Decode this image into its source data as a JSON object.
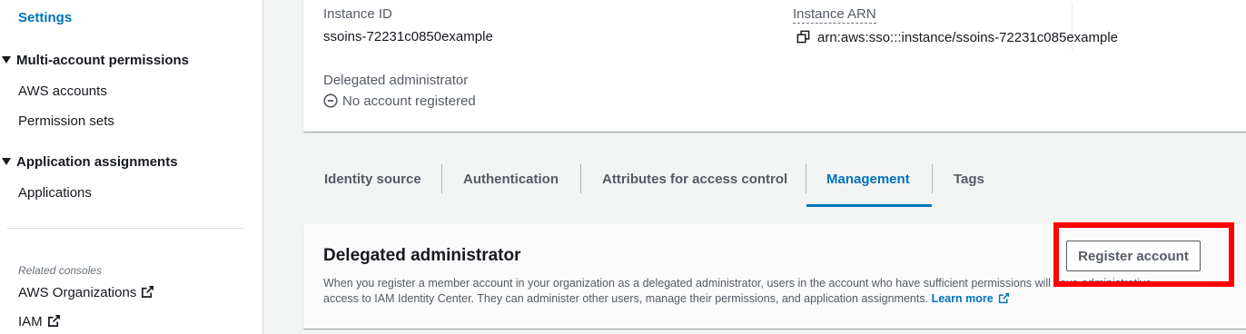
{
  "sidebar": {
    "active_item": "Settings",
    "sections": [
      {
        "title": "Multi-account permissions",
        "items": [
          "AWS accounts",
          "Permission sets"
        ]
      },
      {
        "title": "Application assignments",
        "items": [
          "Applications"
        ]
      }
    ],
    "related_consoles_label": "Related consoles",
    "related_consoles": [
      "AWS Organizations",
      "IAM"
    ]
  },
  "details": {
    "instance_id_label": "Instance ID",
    "instance_id_value": "ssoins-72231c0850example",
    "instance_arn_label": "Instance ARN",
    "instance_arn_value": "arn:aws:sso:::instance/ssoins-72231c085example",
    "delegated_admin_label": "Delegated administrator",
    "delegated_admin_value": "No account registered"
  },
  "tabs": [
    "Identity source",
    "Authentication",
    "Attributes for access control",
    "Management",
    "Tags"
  ],
  "active_tab": "Management",
  "panel": {
    "title": "Delegated administrator",
    "description_line1": "When you register a member account in your organization as a delegated administrator, users in the account who have sufficient permissions will have administrative",
    "description_line2": "access to IAM Identity Center. They can administer other users, manage their permissions, and application assignments.",
    "learn_more": "Learn more",
    "register_button": "Register account"
  },
  "colors": {
    "accent": "#0073bb",
    "highlight": "#ff0000"
  }
}
